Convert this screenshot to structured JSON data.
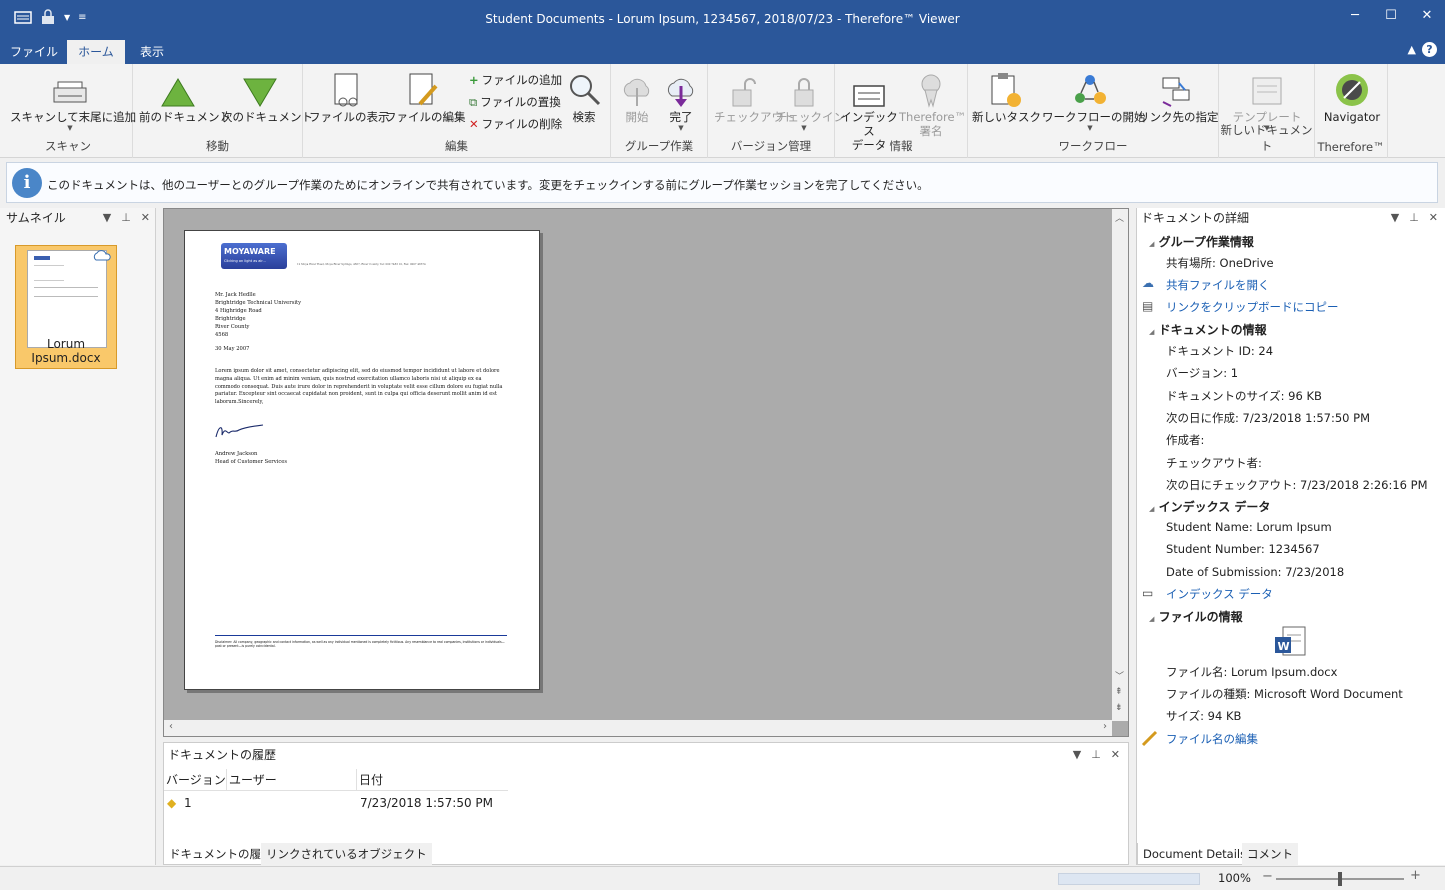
{
  "window": {
    "title": "Student Documents - Lorum Ipsum, 1234567, 2018/07/23 - Therefore™ Viewer"
  },
  "menu_tabs": [
    "ファイル",
    "ホーム",
    "表示"
  ],
  "ribbon": {
    "scan": {
      "add_label": "スキャンして末尾に追加",
      "group": "スキャン"
    },
    "move": {
      "prev": "前のドキュメント",
      "next": "次のドキュメント",
      "group": "移動"
    },
    "edit": {
      "view": "ファイルの表示",
      "edit": "ファイルの編集",
      "add": "ファイルの追加",
      "replace": "ファイルの置換",
      "delete": "ファイルの削除",
      "search": "検索",
      "group": "編集"
    },
    "collab": {
      "start": "開始",
      "finish": "完了",
      "group": "グループ作業"
    },
    "version": {
      "checkout": "チェックアウト",
      "checkin": "チェックイン",
      "group": "バージョン管理"
    },
    "info": {
      "index": "インデックス\nデータ",
      "sign": "Therefore™\n署名",
      "group": "情報"
    },
    "workflow": {
      "task": "新しいタスク",
      "start": "ワークフローの開始",
      "link": "リンク先の指定",
      "group": "ワークフロー"
    },
    "newdoc": {
      "template": "テンプレート",
      "group": "新しいドキュメント"
    },
    "therefore": {
      "navigator": "Navigator",
      "group": "Therefore™"
    }
  },
  "infobar": {
    "message": "このドキュメントは、他のユーザーとのグループ作業のためにオンラインで共有されています。変更をチェックインする前にグループ作業セッションを完了してください。"
  },
  "thumbnails": {
    "title": "サムネイル",
    "items": [
      {
        "label": "Lorum Ipsum.docx"
      }
    ]
  },
  "letter": {
    "logo": "MOYAWARE",
    "tagline": "Clicking on light as air...",
    "address_line": "12 Moya River Road, Moya River Springs, 4567, River County, Tel: 000 7483 10, Fax: 0007 48374",
    "recipient": [
      "Mr. Jack Hedlle",
      "Brightridge Technical University",
      "4 Highridge Road",
      "Brightridge",
      "River County",
      "4568"
    ],
    "date": "30 May 2007",
    "body": "Lorem ipsum dolor sit amet, consectetur adipiscing elit, sed do eiusmod tempor incididunt ut labore et dolore magna aliqua. Ut enim ad minim veniam, quis nostrud exercitation ullamco laboris nisi ut aliquip ex ea commodo consequat. Duis aute irure dolor in reprehenderit in voluptate velit esse cillum dolore eu fugiat nulla pariatur. Excepteur sint occaecat cupidatat non proident, sunt in culpa qui officia deserunt mollit anim id est laborum.Sincerely,",
    "signer": "Andrew Jackson",
    "signer_title": "Head of Customer Services",
    "disclaimer": "Disclaimer: All company, geographic and contact information, as well as any individual mentioned is completely fictitious. Any resemblance to real companies, institutions or individuals—past or present—is purely coincidental."
  },
  "history": {
    "title": "ドキュメントの履歴",
    "columns": [
      "バージョン",
      "ユーザー",
      "日付"
    ],
    "rows": [
      {
        "version": "1",
        "user": "",
        "date": "7/23/2018 1:57:50 PM"
      }
    ],
    "tabs": [
      "ドキュメントの履歴",
      "リンクされているオブジェクト"
    ]
  },
  "details": {
    "title": "ドキュメントの詳細",
    "collab_section": "グループ作業情報",
    "share_location": "共有場所:  OneDrive",
    "open_shared": "共有ファイルを開く",
    "copy_link": "リンクをクリップボードにコピー",
    "doc_section": "ドキュメントの情報",
    "doc_id": "ドキュメント ID: 24",
    "version": "バージョン: 1",
    "size": "ドキュメントのサイズ: 96 KB",
    "created": "次の日に作成: 7/23/2018 1:57:50 PM",
    "creator": "作成者:",
    "checked_out_by": "チェックアウト者:",
    "checked_out_on": "次の日にチェックアウト: 7/23/2018 2:26:16 PM",
    "index_section": "インデックス データ",
    "student_name": "Student Name:  Lorum Ipsum",
    "student_number": "Student Number:  1234567",
    "submission": "Date of Submission:  7/23/2018",
    "index_link": "インデックス データ",
    "file_section": "ファイルの情報",
    "file_name": "ファイル名: Lorum Ipsum.docx",
    "file_type": "ファイルの種類: Microsoft Word Document",
    "file_size": "サイズ: 94 KB",
    "rename": "ファイル名の編集",
    "tabs": [
      "Document Details",
      "コメント"
    ]
  },
  "status": {
    "zoom": "100%",
    "zoom_level": 0.5
  }
}
